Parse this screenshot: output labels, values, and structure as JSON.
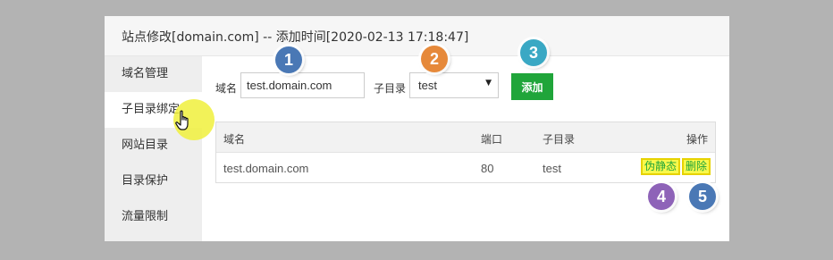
{
  "dialog": {
    "title": "站点修改[domain.com] -- 添加时间[2020-02-13 17:18:47]"
  },
  "sidebar": {
    "items": [
      {
        "label": "域名管理"
      },
      {
        "label": "子目录绑定",
        "active": true
      },
      {
        "label": "网站目录"
      },
      {
        "label": "目录保护"
      },
      {
        "label": "流量限制"
      }
    ]
  },
  "form": {
    "domain_label": "域名",
    "domain_value": "test.domain.com",
    "subdir_label": "子目录",
    "subdir_value": "test",
    "add_label": "添加"
  },
  "table": {
    "headers": {
      "domain": "域名",
      "port": "端口",
      "subdir": "子目录",
      "ops": "操作"
    },
    "rows": [
      {
        "domain": "test.domain.com",
        "port": "80",
        "subdir": "test",
        "actions": {
          "rewrite": "伪静态",
          "delete": "删除"
        }
      }
    ]
  },
  "annotations": [
    {
      "num": "1",
      "color": "#4a78b5"
    },
    {
      "num": "2",
      "color": "#e6893a"
    },
    {
      "num": "3",
      "color": "#3aa8c4"
    },
    {
      "num": "4",
      "color": "#8e63b8"
    },
    {
      "num": "5",
      "color": "#4a78b5"
    }
  ],
  "icons": {
    "cursor": "hand-pointer-icon",
    "select_caret": "caret-down-icon"
  },
  "colors": {
    "primary_green": "#20a53a",
    "highlight_yellow": "#f8f84c",
    "background_gray": "#b3b3b3"
  }
}
